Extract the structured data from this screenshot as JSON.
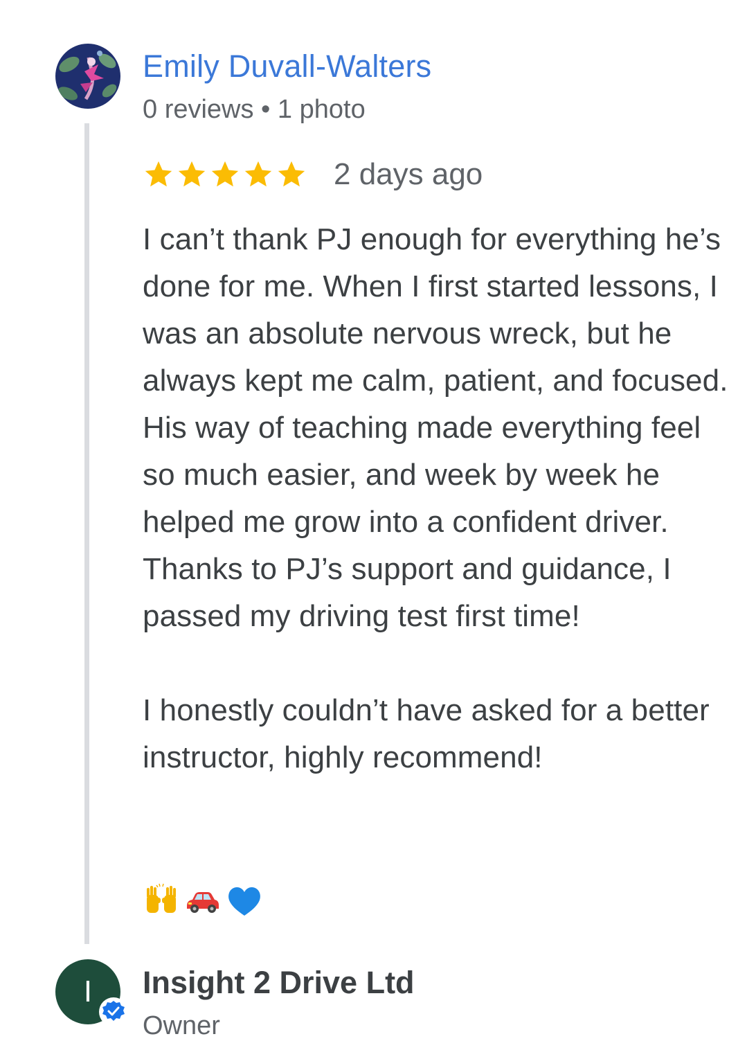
{
  "review": {
    "reviewer_name": "Emily Duvall-Walters",
    "reviewer_meta": "0 reviews • 1 photo",
    "rating": 5,
    "rating_max": 5,
    "date": "2 days ago",
    "text": "I can’t thank PJ enough for everything he’s done for me. When I first started lessons, I was an absolute nervous wreck, but he always kept me calm, patient, and focused. His way of teaching made everything feel so much easier, and week by week he helped me grow into a confident driver. Thanks to PJ’s support and guidance, I passed my driving test first time!\n\nI honestly couldn’t have asked for a better instructor, highly recommend!",
    "emojis": [
      "raising-hands-icon",
      "car-icon",
      "blue-heart-icon"
    ],
    "star_color": "#fbbc04",
    "name_color": "#3b78d8"
  },
  "owner_reply": {
    "avatar_letter": "I",
    "name": "Insight 2 Drive Ltd",
    "role": "Owner",
    "avatar_color": "#1e4d3b",
    "badge_icon": "verified-check-icon",
    "badge_color": "#1a73e8"
  }
}
